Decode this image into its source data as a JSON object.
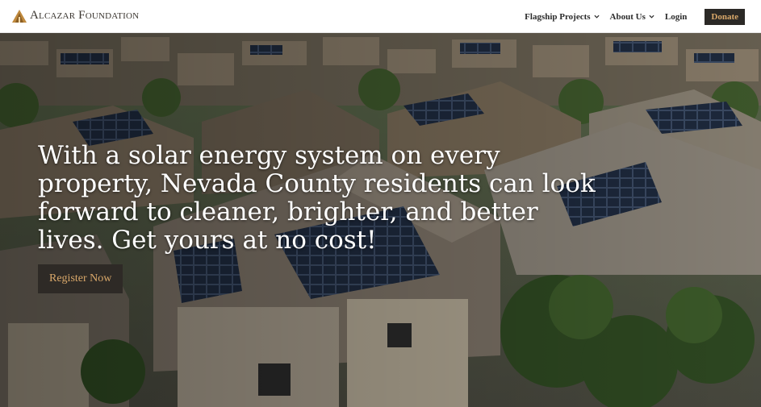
{
  "header": {
    "logo_text": "Alcazar Foundation",
    "nav": {
      "flagship_label": "Flagship Projects",
      "about_label": "About Us",
      "login_label": "Login",
      "donate_label": "Donate"
    }
  },
  "hero": {
    "headline": "With a solar energy system on every property, Nevada County residents can look forward to cleaner, brighter, and better lives. Get yours at no cost!",
    "cta_label": "Register Now",
    "image": "aerial-view-of-suburban-homes-with-rooftop-solar-panels"
  },
  "colors": {
    "accent": "#d9a86a",
    "button_bg": "#2e2a26",
    "header_bg": "#ffffff"
  }
}
